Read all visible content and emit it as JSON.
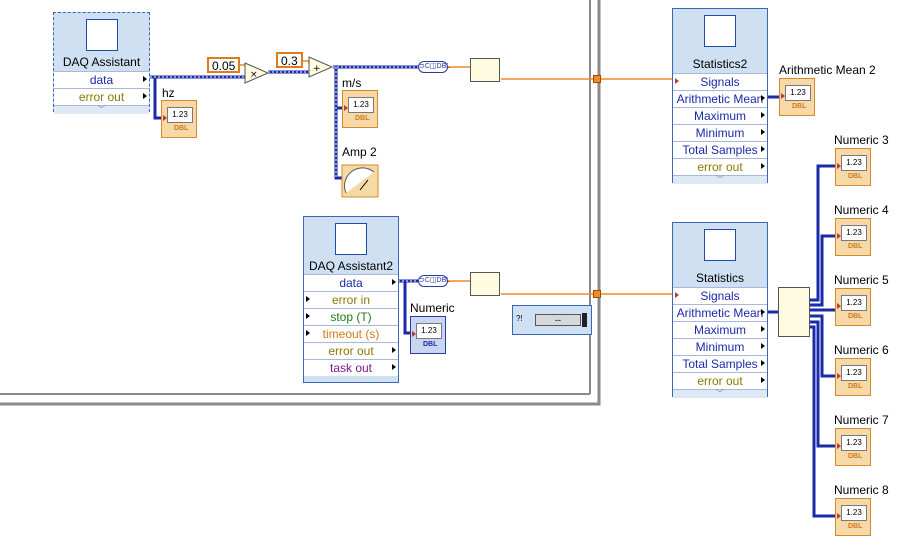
{
  "daq1": {
    "title": "DAQ Assistant",
    "terms": [
      "data",
      "error out"
    ]
  },
  "daq2": {
    "title": "DAQ Assistant2",
    "terms": [
      "data",
      "error in",
      "stop (T)",
      "timeout (s)",
      "error out",
      "task out"
    ]
  },
  "stats2": {
    "title": "Statistics2",
    "terms": [
      "Signals",
      "Arithmetic Mean",
      "Maximum",
      "Minimum",
      "Total Samples",
      "error out"
    ]
  },
  "stats": {
    "title": "Statistics",
    "terms": [
      "Signals",
      "Arithmetic Mean",
      "Maximum",
      "Minimum",
      "Total Samples",
      "error out"
    ]
  },
  "constants": {
    "c1": "0.05",
    "c2": "0.3"
  },
  "labels": {
    "hz": "hz",
    "ms": "m/s",
    "amp2": "Amp 2",
    "numeric": "Numeric",
    "mean2": "Arithmetic Mean 2",
    "n3": "Numeric 3",
    "n4": "Numeric 4",
    "n5": "Numeric 5",
    "n6": "Numeric 6",
    "n7": "Numeric 7",
    "n8": "Numeric 8"
  },
  "indicator": {
    "value": "1.23",
    "type": "DBL"
  },
  "slider": {
    "tag": "?!",
    "value": "--"
  },
  "colors": {
    "dynamic_wire": "#1a2aa8",
    "numeric_wire": "#f08a24",
    "loop_border": "#8a8a8a"
  }
}
